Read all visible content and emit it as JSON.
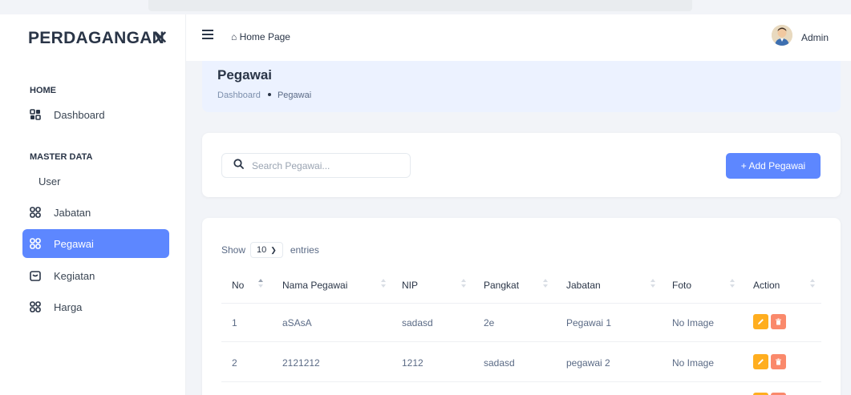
{
  "sidebar": {
    "brand": "PERDAGANGAN",
    "close_icon": "close-icon",
    "sections": {
      "home": "HOME",
      "master": "MASTER DATA"
    },
    "items": [
      {
        "label": "Dashboard",
        "icon": "grid-icon",
        "active": false
      },
      {
        "label": "User",
        "icon": "",
        "active": false
      },
      {
        "label": "Jabatan",
        "icon": "grid-icon",
        "active": false
      },
      {
        "label": "Pegawai",
        "icon": "grid-icon",
        "active": true
      },
      {
        "label": "Kegiatan",
        "icon": "calendar-icon",
        "active": false
      },
      {
        "label": "Harga",
        "icon": "grid-icon",
        "active": false
      }
    ]
  },
  "header": {
    "menu_icon": "hamburger-icon",
    "home_link": "Home Page",
    "home_icon": "home-icon",
    "user_name": "Admin"
  },
  "banner": {
    "title": "Pegawai",
    "breadcrumb": [
      "Dashboard",
      "Pegawai"
    ]
  },
  "toolbar": {
    "search_placeholder": "Search Pegawai...",
    "add_label": "+ Add Pegawai"
  },
  "table": {
    "show_label": "Show",
    "entries_value": "10",
    "entries_label": "entries",
    "columns": [
      "No",
      "Nama Pegawai",
      "NIP",
      "Pangkat",
      "Jabatan",
      "Foto",
      "Action"
    ],
    "rows": [
      {
        "no": "1",
        "nama": "aSAsA",
        "nip": "sadasd",
        "pangkat": "2e",
        "jabatan": "Pegawai 1",
        "foto": "No Image"
      },
      {
        "no": "2",
        "nama": "2121212",
        "nip": "1212",
        "pangkat": "sadasd",
        "jabatan": "pegawai 2",
        "foto": "No Image"
      }
    ]
  },
  "colors": {
    "primary": "#5d87ff",
    "warning": "#ffae1f",
    "danger": "#fa896b",
    "banner": "#ecf2ff"
  }
}
